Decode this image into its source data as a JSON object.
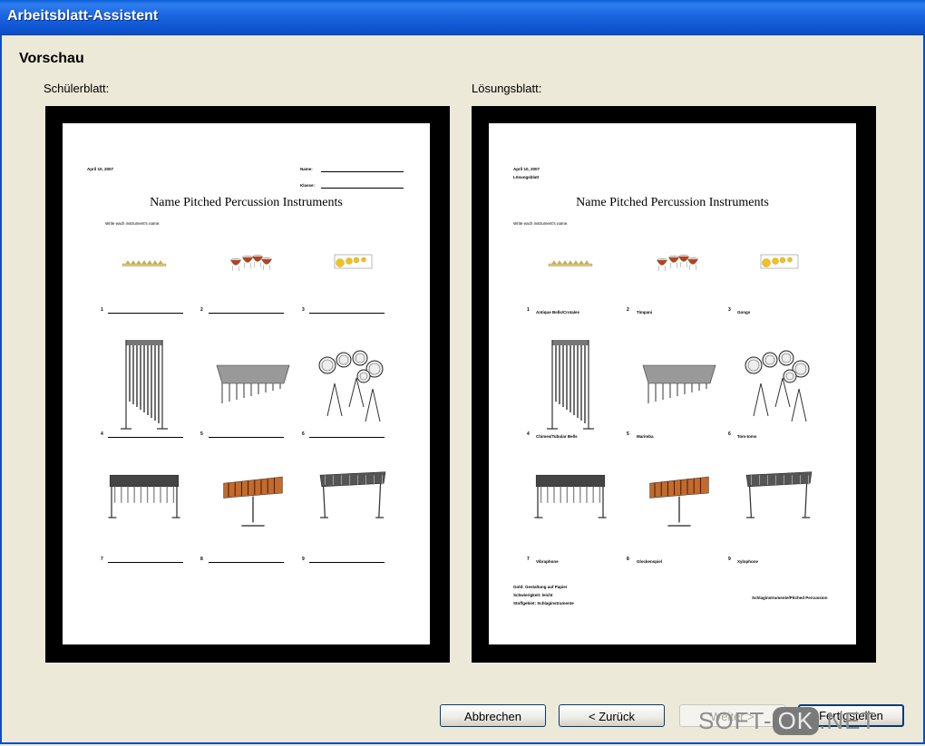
{
  "window": {
    "title": "Arbeitsblatt-Assistent"
  },
  "section": {
    "title": "Vorschau"
  },
  "student": {
    "label": "Schülerblatt:"
  },
  "solution": {
    "label": "Lösungsblatt:"
  },
  "worksheet": {
    "title": "Name Pitched Percussion Instruments",
    "date": "April 10, 2007",
    "name_label": "Name:",
    "class_label": "Klasse:",
    "instruction": "Write each instrument's name.",
    "solution_tag": "Lösungsblatt",
    "numbers": [
      "1",
      "2",
      "3",
      "4",
      "5",
      "6",
      "7",
      "8",
      "9"
    ],
    "answers": [
      "Antique Bells/Crotales",
      "Timpani",
      "Gongs",
      "Chimes/Tubular Bells",
      "Marimba",
      "Tom-toms",
      "Vibraphone",
      "Glockenspiel",
      "Xylophone"
    ],
    "footer_left": [
      "Gold: Gestaltung auf Papier",
      "Schwierigkeit: leicht",
      "Stoffgebiet: Schlaginstrumente"
    ],
    "footer_right": "Schlaginstrumente/Pitched Percussion"
  },
  "buttons": {
    "cancel": "Abbrechen",
    "back": "< Zurück",
    "next": "Weiter >",
    "finish": "Fertigstellen"
  },
  "watermark": {
    "left": "SOFT-",
    "ok": "OK",
    "right": ".NET"
  }
}
